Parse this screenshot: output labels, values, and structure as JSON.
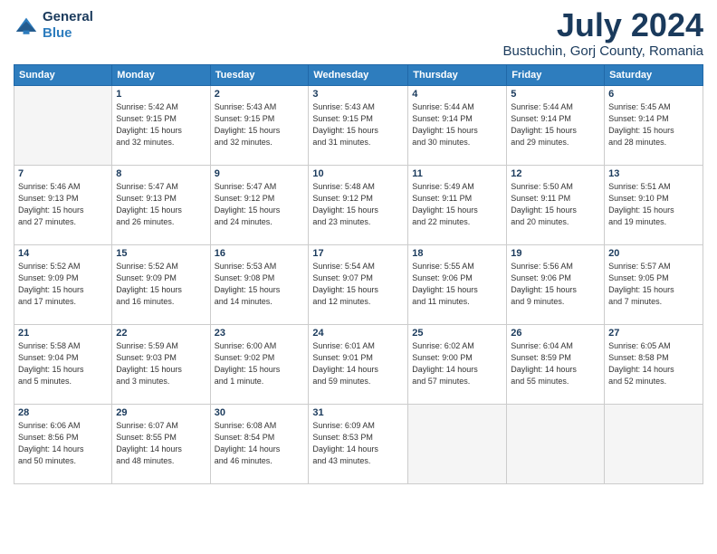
{
  "header": {
    "logo_line1": "General",
    "logo_line2": "Blue",
    "month": "July 2024",
    "location": "Bustuchin, Gorj County, Romania"
  },
  "weekdays": [
    "Sunday",
    "Monday",
    "Tuesday",
    "Wednesday",
    "Thursday",
    "Friday",
    "Saturday"
  ],
  "weeks": [
    [
      {
        "day": "",
        "info": ""
      },
      {
        "day": "1",
        "info": "Sunrise: 5:42 AM\nSunset: 9:15 PM\nDaylight: 15 hours\nand 32 minutes."
      },
      {
        "day": "2",
        "info": "Sunrise: 5:43 AM\nSunset: 9:15 PM\nDaylight: 15 hours\nand 32 minutes."
      },
      {
        "day": "3",
        "info": "Sunrise: 5:43 AM\nSunset: 9:15 PM\nDaylight: 15 hours\nand 31 minutes."
      },
      {
        "day": "4",
        "info": "Sunrise: 5:44 AM\nSunset: 9:14 PM\nDaylight: 15 hours\nand 30 minutes."
      },
      {
        "day": "5",
        "info": "Sunrise: 5:44 AM\nSunset: 9:14 PM\nDaylight: 15 hours\nand 29 minutes."
      },
      {
        "day": "6",
        "info": "Sunrise: 5:45 AM\nSunset: 9:14 PM\nDaylight: 15 hours\nand 28 minutes."
      }
    ],
    [
      {
        "day": "7",
        "info": "Sunrise: 5:46 AM\nSunset: 9:13 PM\nDaylight: 15 hours\nand 27 minutes."
      },
      {
        "day": "8",
        "info": "Sunrise: 5:47 AM\nSunset: 9:13 PM\nDaylight: 15 hours\nand 26 minutes."
      },
      {
        "day": "9",
        "info": "Sunrise: 5:47 AM\nSunset: 9:12 PM\nDaylight: 15 hours\nand 24 minutes."
      },
      {
        "day": "10",
        "info": "Sunrise: 5:48 AM\nSunset: 9:12 PM\nDaylight: 15 hours\nand 23 minutes."
      },
      {
        "day": "11",
        "info": "Sunrise: 5:49 AM\nSunset: 9:11 PM\nDaylight: 15 hours\nand 22 minutes."
      },
      {
        "day": "12",
        "info": "Sunrise: 5:50 AM\nSunset: 9:11 PM\nDaylight: 15 hours\nand 20 minutes."
      },
      {
        "day": "13",
        "info": "Sunrise: 5:51 AM\nSunset: 9:10 PM\nDaylight: 15 hours\nand 19 minutes."
      }
    ],
    [
      {
        "day": "14",
        "info": "Sunrise: 5:52 AM\nSunset: 9:09 PM\nDaylight: 15 hours\nand 17 minutes."
      },
      {
        "day": "15",
        "info": "Sunrise: 5:52 AM\nSunset: 9:09 PM\nDaylight: 15 hours\nand 16 minutes."
      },
      {
        "day": "16",
        "info": "Sunrise: 5:53 AM\nSunset: 9:08 PM\nDaylight: 15 hours\nand 14 minutes."
      },
      {
        "day": "17",
        "info": "Sunrise: 5:54 AM\nSunset: 9:07 PM\nDaylight: 15 hours\nand 12 minutes."
      },
      {
        "day": "18",
        "info": "Sunrise: 5:55 AM\nSunset: 9:06 PM\nDaylight: 15 hours\nand 11 minutes."
      },
      {
        "day": "19",
        "info": "Sunrise: 5:56 AM\nSunset: 9:06 PM\nDaylight: 15 hours\nand 9 minutes."
      },
      {
        "day": "20",
        "info": "Sunrise: 5:57 AM\nSunset: 9:05 PM\nDaylight: 15 hours\nand 7 minutes."
      }
    ],
    [
      {
        "day": "21",
        "info": "Sunrise: 5:58 AM\nSunset: 9:04 PM\nDaylight: 15 hours\nand 5 minutes."
      },
      {
        "day": "22",
        "info": "Sunrise: 5:59 AM\nSunset: 9:03 PM\nDaylight: 15 hours\nand 3 minutes."
      },
      {
        "day": "23",
        "info": "Sunrise: 6:00 AM\nSunset: 9:02 PM\nDaylight: 15 hours\nand 1 minute."
      },
      {
        "day": "24",
        "info": "Sunrise: 6:01 AM\nSunset: 9:01 PM\nDaylight: 14 hours\nand 59 minutes."
      },
      {
        "day": "25",
        "info": "Sunrise: 6:02 AM\nSunset: 9:00 PM\nDaylight: 14 hours\nand 57 minutes."
      },
      {
        "day": "26",
        "info": "Sunrise: 6:04 AM\nSunset: 8:59 PM\nDaylight: 14 hours\nand 55 minutes."
      },
      {
        "day": "27",
        "info": "Sunrise: 6:05 AM\nSunset: 8:58 PM\nDaylight: 14 hours\nand 52 minutes."
      }
    ],
    [
      {
        "day": "28",
        "info": "Sunrise: 6:06 AM\nSunset: 8:56 PM\nDaylight: 14 hours\nand 50 minutes."
      },
      {
        "day": "29",
        "info": "Sunrise: 6:07 AM\nSunset: 8:55 PM\nDaylight: 14 hours\nand 48 minutes."
      },
      {
        "day": "30",
        "info": "Sunrise: 6:08 AM\nSunset: 8:54 PM\nDaylight: 14 hours\nand 46 minutes."
      },
      {
        "day": "31",
        "info": "Sunrise: 6:09 AM\nSunset: 8:53 PM\nDaylight: 14 hours\nand 43 minutes."
      },
      {
        "day": "",
        "info": ""
      },
      {
        "day": "",
        "info": ""
      },
      {
        "day": "",
        "info": ""
      }
    ]
  ]
}
